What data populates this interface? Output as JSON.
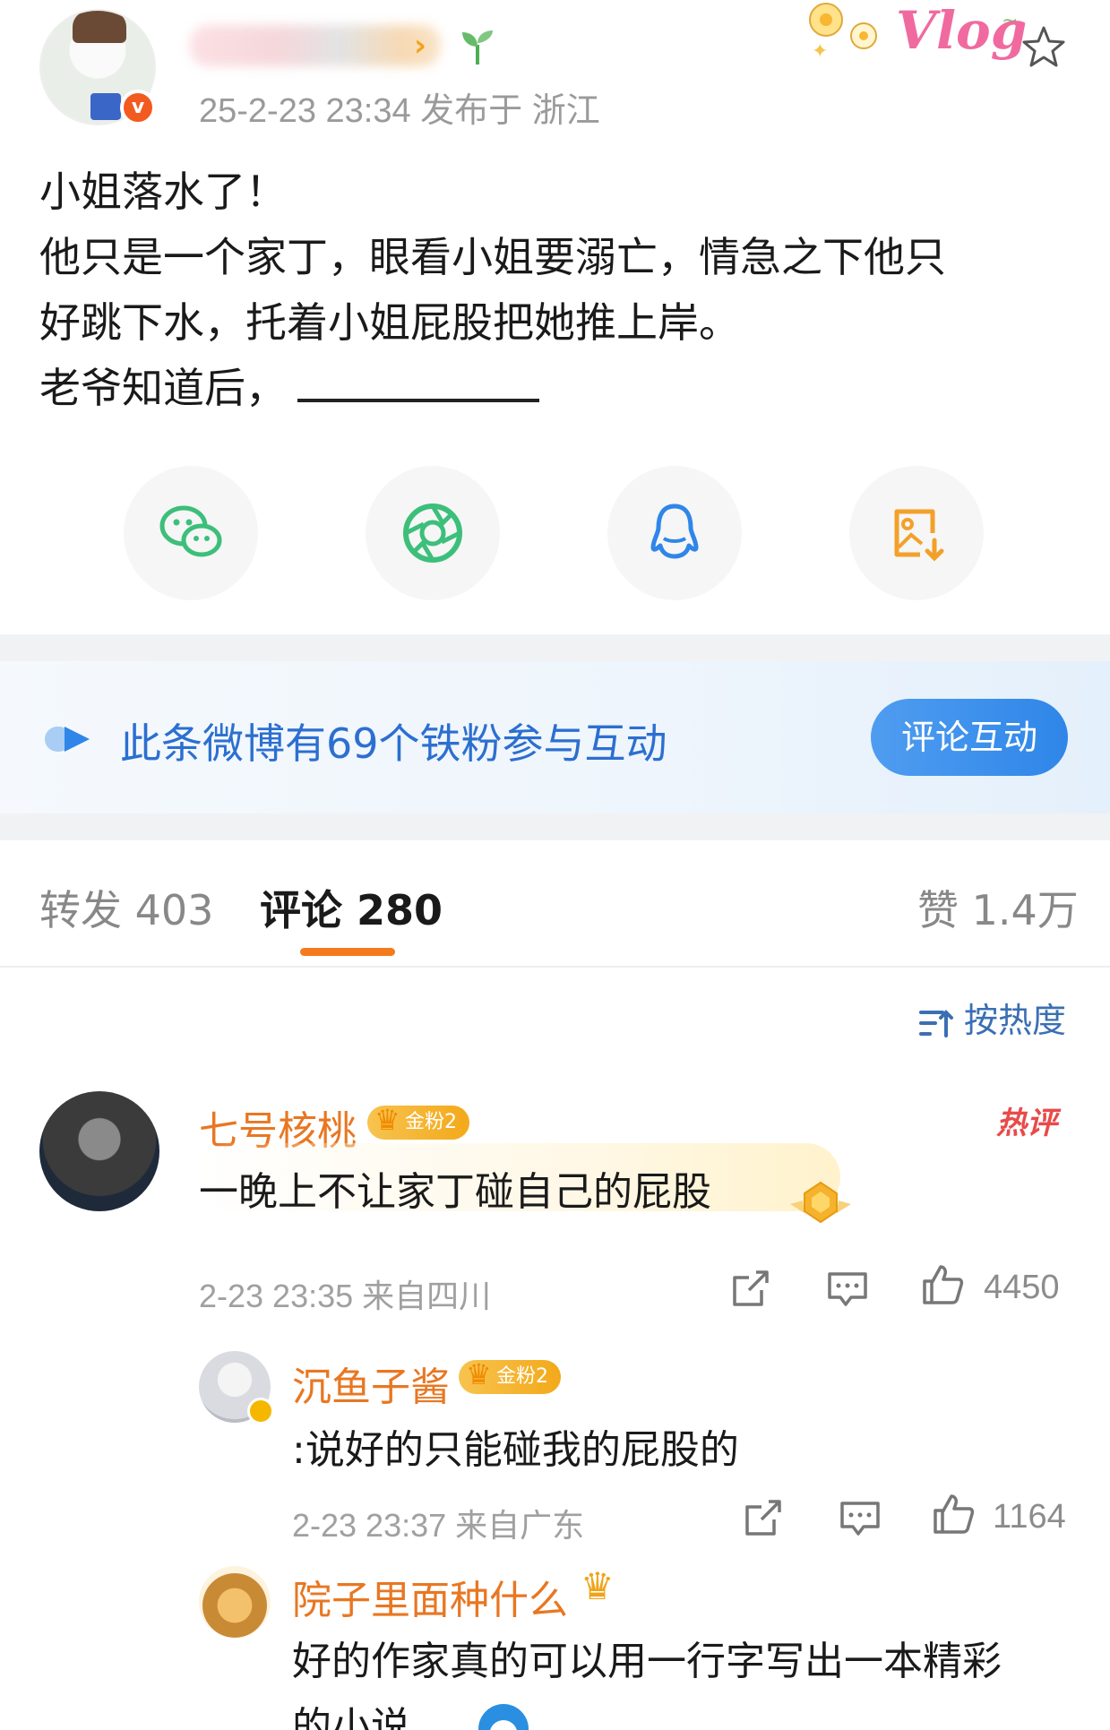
{
  "post": {
    "meta": "25-2-23 23:34  发布于 浙江",
    "sticker_text": "Vlog",
    "lines": [
      "小姐落水了！",
      "他只是一个家丁，眼看小姐要溺亡，情急之下他只",
      "好跳下水，托着小姐屁股把她推上岸。",
      "老爷知道后，"
    ]
  },
  "share": {
    "icons": [
      "wechat-icon",
      "moments-icon",
      "qq-icon",
      "save-image-icon"
    ],
    "colors": {
      "wechat": "#3cbf7a",
      "moments": "#3cbf7a",
      "qq": "#2f86e8",
      "save": "#f3a02a"
    }
  },
  "fans_banner": {
    "text": "此条微博有69个铁粉参与互动",
    "button": "评论互动"
  },
  "tabs": {
    "repost": "转发 403",
    "comments": "评论 280",
    "likes": "赞 1.4万"
  },
  "sort": {
    "label": "按热度"
  },
  "comments": [
    {
      "name": "七号核桃",
      "badge": "金粉2",
      "hot": "热评",
      "text": "一晚上不让家丁碰自己的屁股",
      "meta": "2-23 23:35 来自四川",
      "likes": "4450"
    },
    {
      "name": "沉鱼子酱",
      "badge": "金粉2",
      "text": ":说好的只能碰我的屁股的",
      "meta": "2-23 23:37 来自广东",
      "likes": "1164"
    },
    {
      "name": "院子里面种什么",
      "text_line1": "好的作家真的可以用一行字写出一本精彩",
      "text_line2": "的小说。。"
    }
  ],
  "colors": {
    "accent_orange": "#f37b1d",
    "name_orange": "#e87722",
    "link_blue": "#2c6fd0",
    "hot_red": "#e94a4a"
  }
}
